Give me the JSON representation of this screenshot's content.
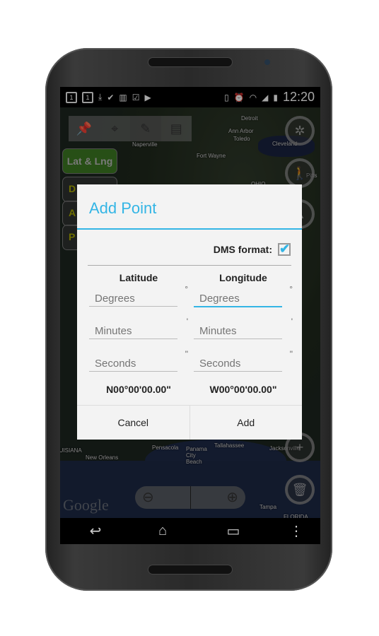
{
  "status": {
    "icons": [
      "notification-1-icon",
      "notification-1-icon",
      "download-icon",
      "check-icon",
      "barcode-icon",
      "clipboard-check-icon",
      "play-store-icon",
      "rotation-icon",
      "alarm-icon",
      "wifi-icon",
      "signal-icon",
      "battery-charging-icon"
    ],
    "time": "12:20"
  },
  "map": {
    "labels": [
      "Detroit",
      "Ann Arbor",
      "Toledo",
      "Cleveland",
      "Naperville",
      "Fort Wayne",
      "OHIO",
      "Pensacola",
      "Panama City Beach",
      "Tallahassee",
      "Jacksonville",
      "LOUISIANA",
      "New Orleans",
      "Tampa",
      "FLORIDA",
      "Pitts"
    ],
    "logo": "Google"
  },
  "toolbar": {
    "tools": [
      "pin-icon",
      "crosshair-icon",
      "pencil-icon",
      "comment-icon"
    ],
    "selected": 2
  },
  "left_buttons": [
    "Lat & Lng",
    "D",
    "A",
    "P"
  ],
  "dialog": {
    "title": "Add Point",
    "dms_label": "DMS format:",
    "dms_checked": true,
    "latitude": {
      "header": "Latitude",
      "fields": [
        {
          "placeholder": "Degrees",
          "unit": "°"
        },
        {
          "placeholder": "Minutes",
          "unit": "'"
        },
        {
          "placeholder": "Seconds",
          "unit": "\""
        }
      ],
      "result": "N00°00'00.00\""
    },
    "longitude": {
      "header": "Longitude",
      "fields": [
        {
          "placeholder": "Degrees",
          "unit": "°"
        },
        {
          "placeholder": "Minutes",
          "unit": "'"
        },
        {
          "placeholder": "Seconds",
          "unit": "\""
        }
      ],
      "result": "W00°00'00.00\""
    },
    "cancel": "Cancel",
    "add": "Add"
  },
  "colors": {
    "accent": "#33b5e5",
    "lat_lng_button": "#3d7a22"
  }
}
